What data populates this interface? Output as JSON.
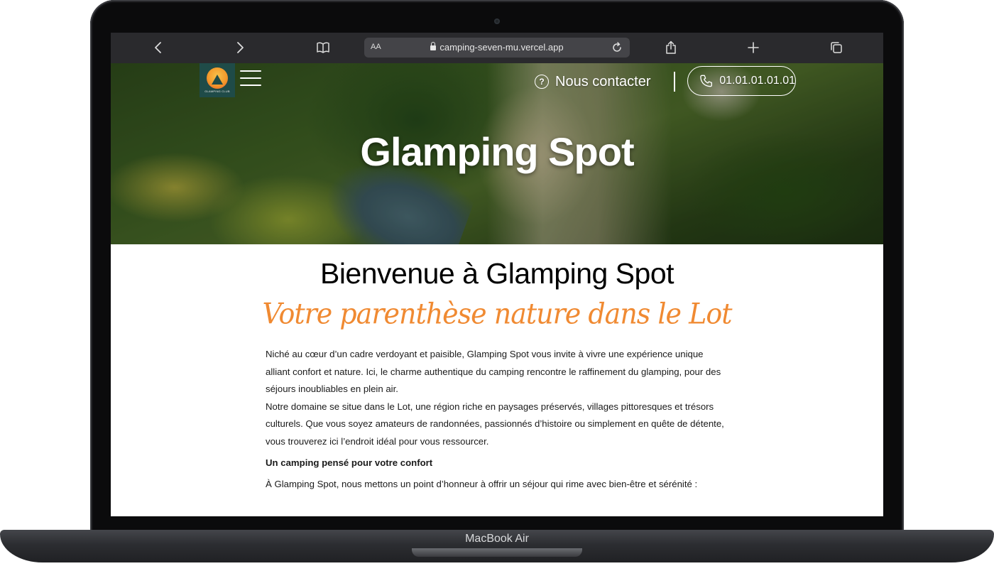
{
  "device": {
    "model_label": "MacBook Air"
  },
  "browser": {
    "text_size_label": "AA",
    "url": "camping-seven-mu.vercel.app",
    "icons": [
      "back-icon",
      "forward-icon",
      "bookmarks-icon",
      "lock-icon",
      "reload-icon",
      "share-icon",
      "new-tab-icon",
      "tabs-icon"
    ]
  },
  "site": {
    "logo_caption": "GLAMPING CLUB",
    "contact_label": "Nous contacter",
    "phone_label": "01.01.01.01.01",
    "hero_title": "Glamping Spot",
    "welcome_title": "Bienvenue à Glamping Spot",
    "tagline": "Votre parenthèse nature dans le Lot",
    "paragraphs": [
      "Niché au cœur d’un cadre verdoyant et paisible, Glamping Spot vous invite à vivre une expérience unique alliant confort et nature. Ici, le charme authentique du camping rencontre le raffinement du glamping, pour des séjours inoubliables en plein air.",
      "Notre domaine se situe dans le Lot, une région riche en paysages préservés, villages pittoresques et trésors culturels. Que vous soyez amateurs de randonnées, passionnés d’histoire ou simplement en quête de détente, vous trouverez ici l’endroit idéal pour vous ressourcer."
    ],
    "subheading": "Un camping pensé pour votre confort",
    "after_subheading": "À Glamping Spot, nous mettons un point d’honneur à offrir un séjour qui rime avec bien-être et sérénité :"
  },
  "colors": {
    "accent_orange": "#f08a32",
    "logo_teal": "#1f4b48",
    "browser_bar": "#2a2a2d"
  }
}
